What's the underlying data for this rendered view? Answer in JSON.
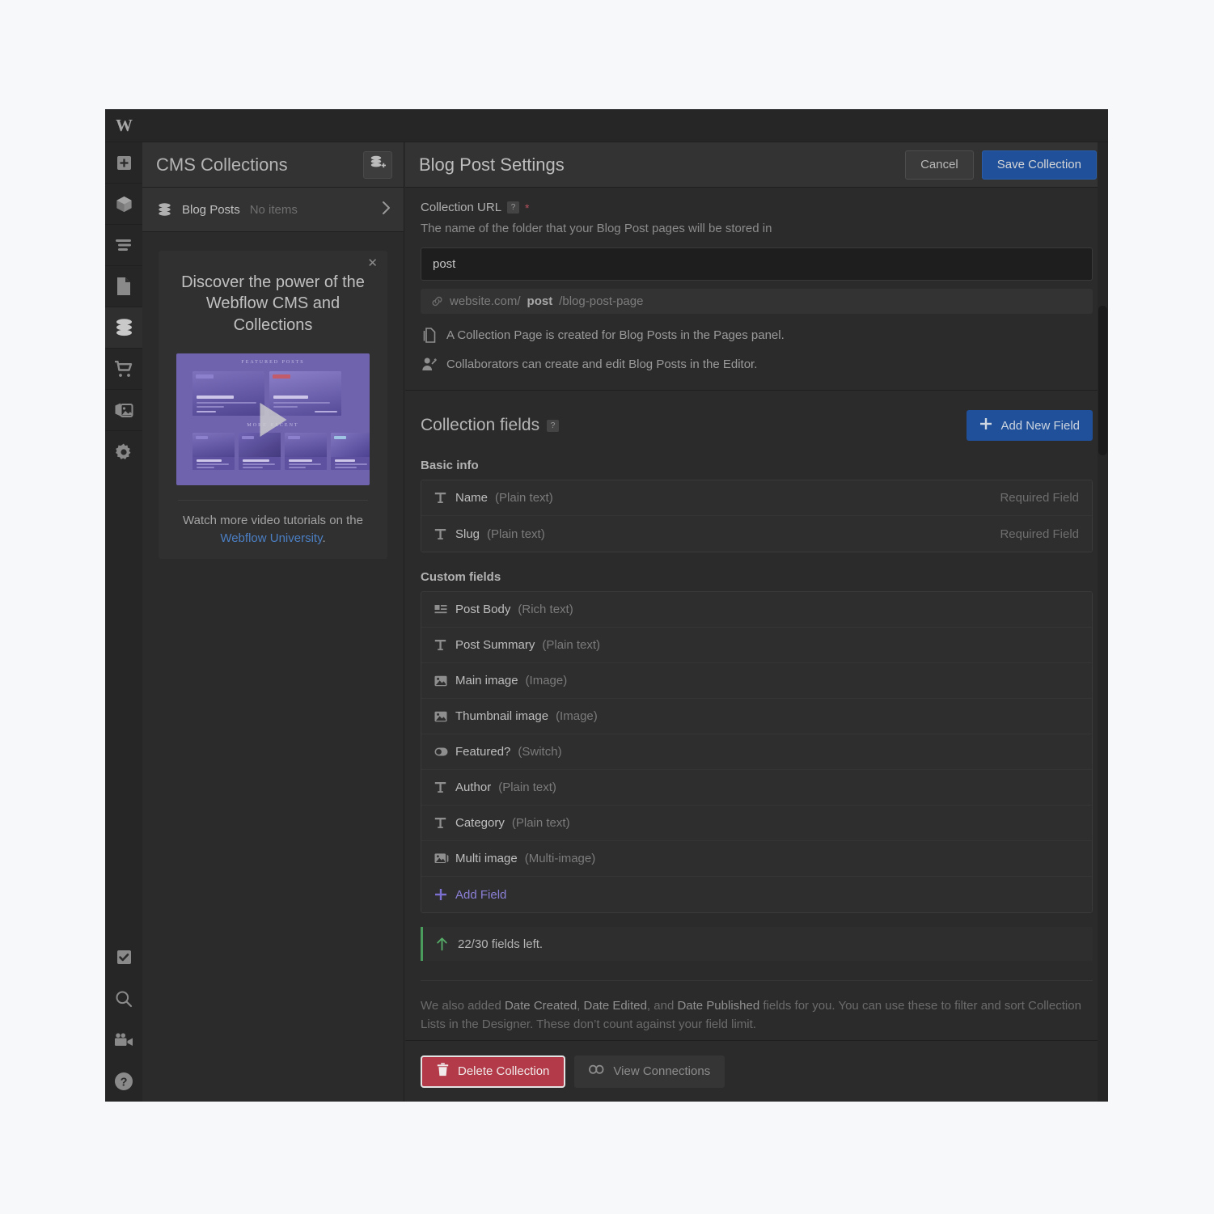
{
  "app": {
    "logo": "W",
    "rail_top": [
      {
        "name": "add-panel",
        "icon": "plus-square-icon"
      },
      {
        "name": "components",
        "icon": "cube-icon"
      },
      {
        "name": "navigator",
        "icon": "navigator-icon"
      },
      {
        "name": "pages",
        "icon": "page-icon"
      },
      {
        "name": "cms",
        "icon": "database-icon",
        "active": true
      },
      {
        "name": "ecommerce",
        "icon": "cart-icon"
      },
      {
        "name": "assets",
        "icon": "images-icon"
      },
      {
        "name": "settings",
        "icon": "gear-icon"
      }
    ],
    "rail_bottom": [
      {
        "name": "audit",
        "icon": "checkbox-icon"
      },
      {
        "name": "search",
        "icon": "search-icon"
      },
      {
        "name": "video",
        "icon": "video-camera-icon"
      },
      {
        "name": "help",
        "icon": "question-circle-icon"
      }
    ]
  },
  "collections_panel": {
    "title": "CMS Collections",
    "new_collection_icon": "database-plus-icon",
    "items": [
      {
        "name": "Blog Posts",
        "count": "No items",
        "icon": "database-icon",
        "chevron": "chevron-right-icon"
      }
    ],
    "promo": {
      "close_icon": "close-icon",
      "title": "Discover the power of the Webflow CMS and Collections",
      "play_icon": "play-icon",
      "footer_text": "Watch more video tutorials on the ",
      "footer_link": "Webflow University",
      "footer_tail": ".",
      "video_labels": {
        "featured": "FEATURED POSTS",
        "recent": "MORE RECENT"
      }
    }
  },
  "settings_panel": {
    "title": "Blog Post Settings",
    "cancel_label": "Cancel",
    "save_label": "Save Collection",
    "url": {
      "label": "Collection URL",
      "help_icon": "question-mark-icon",
      "required_marker": "*",
      "description": "The name of the folder that your Blog Post pages will be stored in",
      "value": "post",
      "placeholder": "post",
      "preview_icon": "link-icon",
      "preview_prefix": "website.com/",
      "preview_slug": "post",
      "preview_suffix": "/blog-post-page"
    },
    "notes": [
      {
        "icon": "pages-icon",
        "text": "A Collection Page is created for Blog Posts in the Pages panel."
      },
      {
        "icon": "user-edit-icon",
        "text": "Collaborators can create and edit Blog Posts in the Editor."
      }
    ],
    "fields": {
      "heading": "Collection fields",
      "help_icon": "question-mark-icon",
      "add_new_label": "Add New Field",
      "add_new_icon": "plus-icon",
      "basic_label": "Basic info",
      "basic": [
        {
          "icon": "text-icon",
          "name": "Name",
          "type": "(Plain text)",
          "required": "Required Field"
        },
        {
          "icon": "text-icon",
          "name": "Slug",
          "type": "(Plain text)",
          "required": "Required Field"
        }
      ],
      "custom_label": "Custom fields",
      "custom": [
        {
          "icon": "rich-text-icon",
          "name": "Post Body",
          "type": "(Rich text)"
        },
        {
          "icon": "text-icon",
          "name": "Post Summary",
          "type": "(Plain text)"
        },
        {
          "icon": "image-icon",
          "name": "Main image",
          "type": "(Image)"
        },
        {
          "icon": "image-icon",
          "name": "Thumbnail image",
          "type": "(Image)"
        },
        {
          "icon": "switch-icon",
          "name": "Featured?",
          "type": "(Switch)"
        },
        {
          "icon": "text-icon",
          "name": "Author",
          "type": "(Plain text)"
        },
        {
          "icon": "text-icon",
          "name": "Category",
          "type": "(Plain text)"
        },
        {
          "icon": "multi-image-icon",
          "name": "Multi image",
          "type": "(Multi-image)"
        }
      ],
      "add_field_label": "Add Field",
      "add_field_icon": "plus-icon",
      "quota_icon": "arrow-up-icon",
      "quota_text": "22/30 fields left.",
      "footnote_a": "We also added ",
      "footnote_b1": "Date Created",
      "footnote_c": ", ",
      "footnote_b2": "Date Edited",
      "footnote_d": ", and ",
      "footnote_b3": "Date Published",
      "footnote_e": " fields for you. You can use these to filter and sort Collection Lists in the Designer. These don’t count against your field limit."
    },
    "footer": {
      "delete_label": "Delete Collection",
      "delete_icon": "trash-icon",
      "connections_label": "View Connections",
      "connections_icon": "link-chain-icon"
    }
  },
  "colors": {
    "accent_blue": "#1f5099",
    "danger_red": "#b33a48",
    "purple": "#6f63ae",
    "green": "#4a9c5c",
    "link_blue": "#4b7fc4"
  }
}
